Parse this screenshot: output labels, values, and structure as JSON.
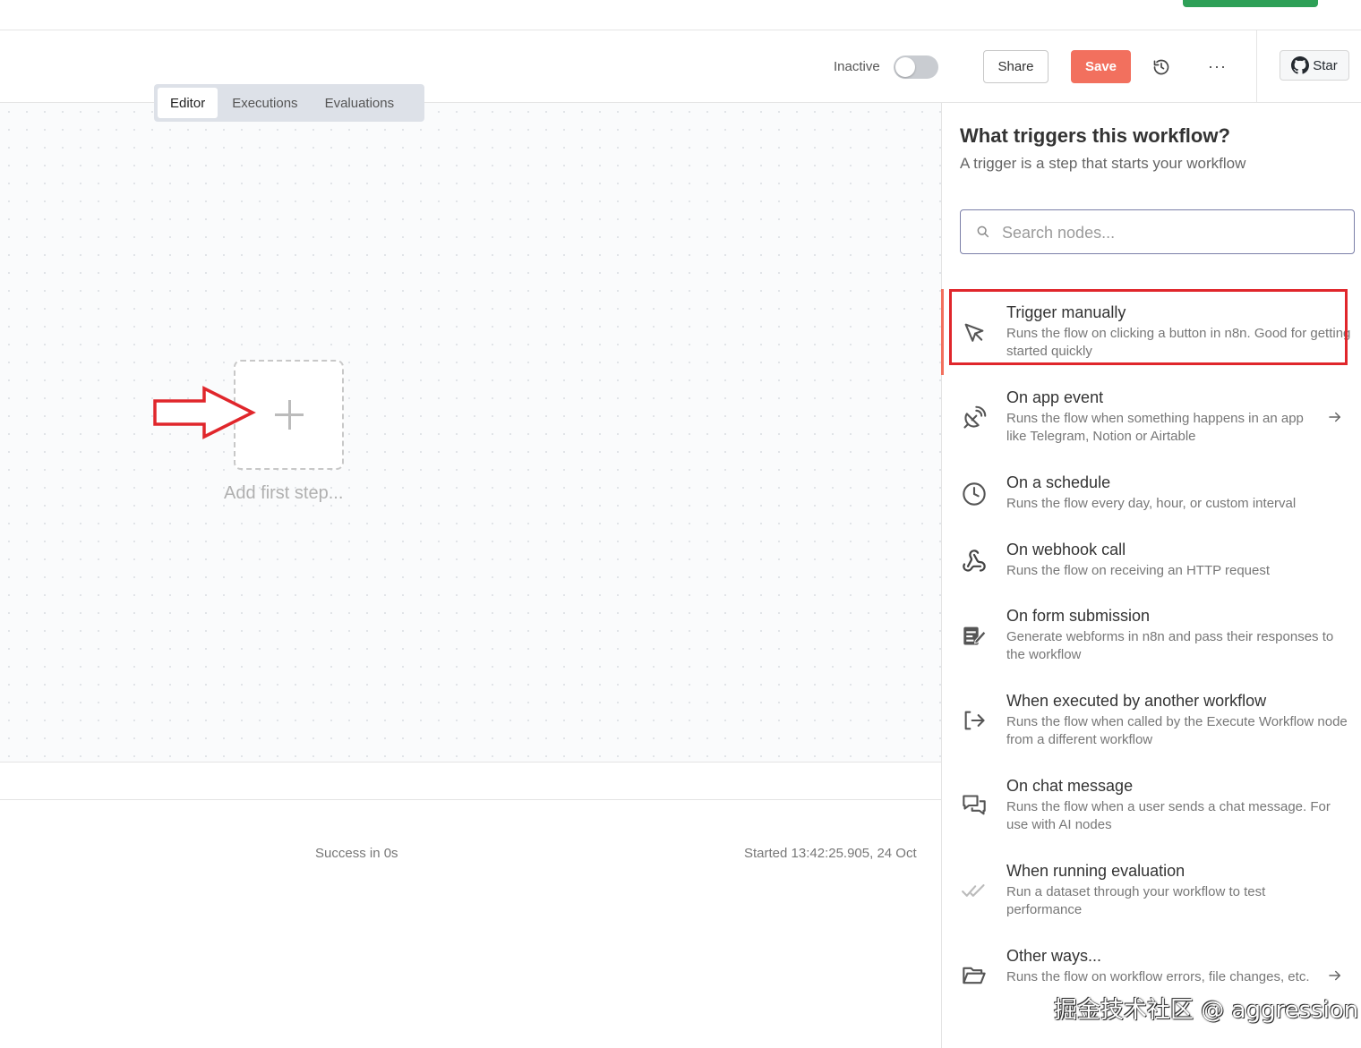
{
  "header": {
    "active_state_label": "Inactive",
    "share_label": "Share",
    "save_label": "Save",
    "more_label": "···",
    "star_label": "Star"
  },
  "tabs": [
    {
      "label": "Editor",
      "active": true
    },
    {
      "label": "Executions",
      "active": false
    },
    {
      "label": "Evaluations",
      "active": false
    }
  ],
  "canvas": {
    "add_first_step_label": "Add first step..."
  },
  "log": {
    "status": "Success in 0s",
    "started": "Started 13:42:25.905, 24 Oct"
  },
  "panel": {
    "title": "What triggers this workflow?",
    "subtitle": "A trigger is a step that starts your workflow",
    "search_placeholder": "Search nodes...",
    "items": [
      {
        "title": "Trigger manually",
        "desc": "Runs the flow on clicking a button in n8n. Good for getting started quickly",
        "icon": "cursor-icon",
        "has_arrow": false
      },
      {
        "title": "On app event",
        "desc": "Runs the flow when something happens in an app like Telegram, Notion or Airtable",
        "icon": "satellite-icon",
        "has_arrow": true
      },
      {
        "title": "On a schedule",
        "desc": "Runs the flow every day, hour, or custom interval",
        "icon": "clock-icon",
        "has_arrow": false
      },
      {
        "title": "On webhook call",
        "desc": "Runs the flow on receiving an HTTP request",
        "icon": "webhook-icon",
        "has_arrow": false
      },
      {
        "title": "On form submission",
        "desc": "Generate webforms in n8n and pass their responses to the workflow",
        "icon": "form-icon",
        "has_arrow": false
      },
      {
        "title": "When executed by another workflow",
        "desc": "Runs the flow when called by the Execute Workflow node from a different workflow",
        "icon": "sign-in-icon",
        "has_arrow": false
      },
      {
        "title": "On chat message",
        "desc": "Runs the flow when a user sends a chat message. For use with AI nodes",
        "icon": "chat-icon",
        "has_arrow": false
      },
      {
        "title": "When running evaluation",
        "desc": "Run a dataset through your workflow to test performance",
        "icon": "check-double-icon",
        "has_arrow": false
      },
      {
        "title": "Other ways...",
        "desc": "Runs the flow on workflow errors, file changes, etc.",
        "icon": "folder-open-icon",
        "has_arrow": true
      }
    ]
  },
  "watermark": "掘金技术社区 @ aggression",
  "colors": {
    "save": "#f2705e",
    "highlight_annotation": "#e0262b",
    "github_green": "#2ea057"
  }
}
